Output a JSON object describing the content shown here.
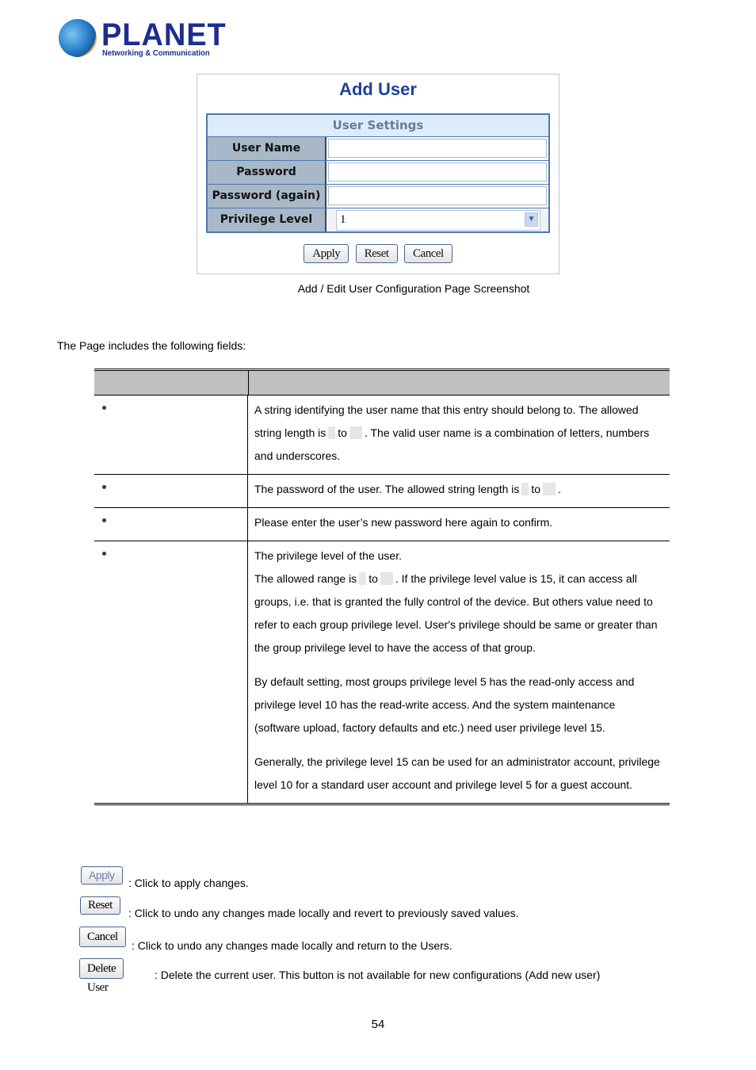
{
  "logo": {
    "brand": "PLANET",
    "tagline": "Networking & Communication"
  },
  "screenshot": {
    "title": "Add User",
    "section_header": "User Settings",
    "fields": [
      {
        "label": "User Name",
        "value": ""
      },
      {
        "label": "Password",
        "value": ""
      },
      {
        "label": "Password (again)",
        "value": ""
      },
      {
        "label": "Privilege Level",
        "value": "1"
      }
    ],
    "buttons": {
      "apply": "Apply",
      "reset": "Reset",
      "cancel": "Cancel"
    }
  },
  "caption": "Add / Edit User Configuration Page Screenshot",
  "intro": "The Page includes the following fields:",
  "table": {
    "headers": [
      "",
      ""
    ],
    "rows": [
      {
        "name": "",
        "desc": [
          {
            "t": "A string identifying the user name that this entry should belong to. The allowed string length is "
          },
          {
            "gap": true
          },
          {
            "t": " to "
          },
          {
            "gap": true
          },
          {
            "t": ". The valid user name is a combination of letters, numbers and underscores."
          }
        ]
      },
      {
        "name": "",
        "desc_a": "The password of the user. The allowed string length is",
        "desc_b": "to",
        "desc_c": "."
      },
      {
        "name": "",
        "desc": "Please enter the user’s new password here again to confirm."
      },
      {
        "name": "",
        "p1_line1": "The privilege level of the user.",
        "p1_a": "The allowed range is",
        "p1_b": "to",
        "p1_c": ". If the privilege level value is 15, it can access all groups, i.e. that is granted the fully control of the device. But others value need to refer to each group privilege level. User's privilege should be same or greater than the group privilege level to have the access of that group.",
        "p2": "By default setting, most groups privilege level 5 has the read-only access and privilege level 10 has the read-write access. And the system maintenance (software upload, factory defaults and etc.) need user privilege level 15.",
        "p3": "Generally, the privilege level 15 can be used for an administrator account, privilege level 10 for a standard user account and privilege level 5 for a guest account."
      }
    ],
    "row0": {
      "a": "A string identifying the user name that this entry should belong to. The allowed string length is",
      "b": "to",
      "c": ". The valid user name is a combination of letters, numbers and underscores."
    }
  },
  "button_legend": [
    {
      "label": "Apply",
      "text": ": Click to apply changes."
    },
    {
      "label": "Reset",
      "text": ": Click to undo any changes made locally and revert to previously saved values."
    },
    {
      "label": "Cancel",
      "text": ": Click to undo any changes made locally and return to the Users."
    },
    {
      "label": "Delete User",
      "text": ": Delete the current user. This button is not available for new configurations (Add new user)"
    }
  ],
  "page_number": "54"
}
